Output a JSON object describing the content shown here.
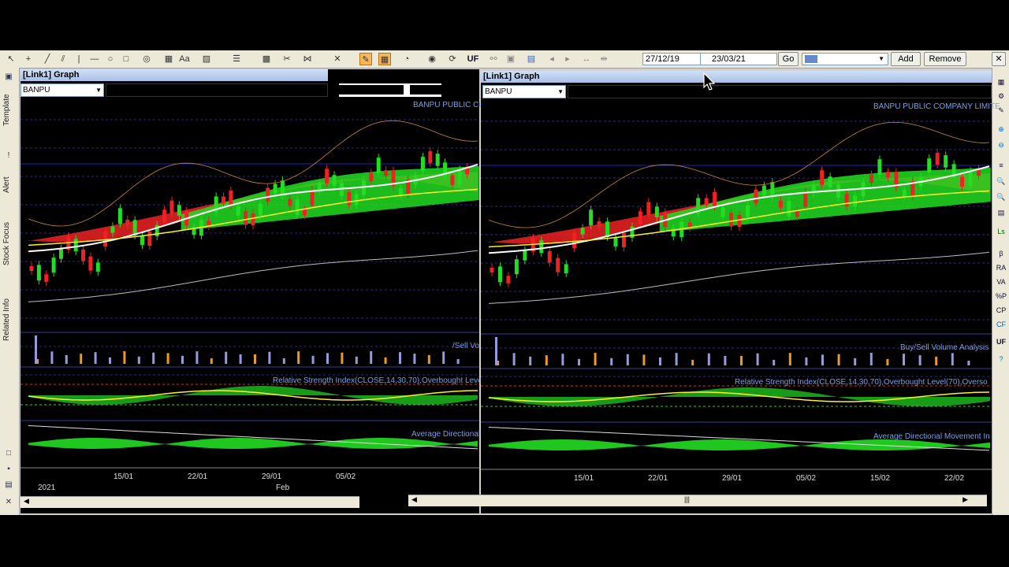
{
  "toolbar": {
    "icons": [
      "arrow-icon",
      "crosshair-icon",
      "line-icon",
      "parallel-icon",
      "vline-icon",
      "hline-icon",
      "circle-icon",
      "rect-icon",
      "fib-icon",
      "text-icon",
      "pattern-icon",
      "lines-style-icon",
      "scissors-icon",
      "star-icon",
      "bars-icon",
      "delete-icon",
      "highlight-icon",
      "grid-icon",
      "zoom-icon",
      "globe-icon",
      "refresh-icon"
    ],
    "uf_label": "UF",
    "date_from": "27/12/19",
    "date_to": "23/03/21",
    "go_label": "Go",
    "add_label": "Add",
    "remove_label": "Remove",
    "close_symbol": "✕"
  },
  "left_sidebar": {
    "tabs": [
      "Template",
      "Alert",
      "Stock Focus",
      "Related Info"
    ]
  },
  "right_sidebar": {
    "items": [
      "▦",
      "⚙",
      "✎",
      "⊕",
      "⊖",
      "≡",
      "🔍",
      "🔍",
      "▤",
      "Ls",
      "β",
      "RA",
      "VA",
      "%P",
      "CP",
      "CF",
      "UF",
      "?"
    ]
  },
  "left_panel": {
    "title": "[Link1] Graph",
    "symbol": "BANPU",
    "company_label": "BANPU PUBLIC CO",
    "volume_label": "/Sell Vo",
    "rsi_label": "Relative Strength Index(CLOSE,14,30,70),Overbought Level",
    "adx_label": "Average Directional",
    "x_ticks": [
      "15/01",
      "22/01",
      "29/01",
      "05/02"
    ],
    "x_period": [
      "2021",
      "Feb"
    ]
  },
  "right_panel": {
    "title": "[Link1] Graph",
    "symbol": "BANPU",
    "company_label": "BANPU PUBLIC COMPANY LIMITE",
    "volume_label": "Buy/Sell Volume Analysis",
    "rsi_label": "Relative Strength Index(CLOSE,14,30,70),Overbought Level(70),Overso",
    "adx_label": "Average Directional Movement In",
    "x_ticks": [
      "15/01",
      "22/01",
      "29/01",
      "05/02",
      "15/02",
      "22/02"
    ]
  },
  "colors": {
    "bull": "#22dd22",
    "bear": "#ee2222",
    "ma_white": "#ffffff",
    "ma_yellow": "#ffee33",
    "label_blue": "#7d9fe8"
  }
}
